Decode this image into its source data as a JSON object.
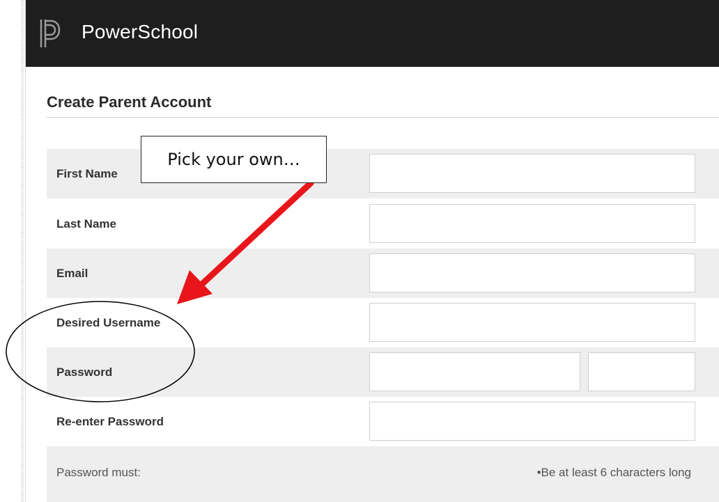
{
  "app": {
    "brand": "PowerSchool",
    "logo_icon": "powerschool-logo-icon"
  },
  "page": {
    "title": "Create Parent Account"
  },
  "form": {
    "fields": [
      {
        "label": "First Name",
        "value": ""
      },
      {
        "label": "Last Name",
        "value": ""
      },
      {
        "label": "Email",
        "value": ""
      },
      {
        "label": "Desired Username",
        "value": ""
      },
      {
        "label": "Password",
        "value": ""
      },
      {
        "label": "Re-enter Password",
        "value": ""
      }
    ],
    "password_rules_label": "Password must:",
    "password_rules": [
      "•Be at least 6 characters long"
    ]
  },
  "annotation": {
    "callout_text": "Pick your own…",
    "arrow_color": "#e8161b",
    "ellipse_color": "#000000"
  }
}
